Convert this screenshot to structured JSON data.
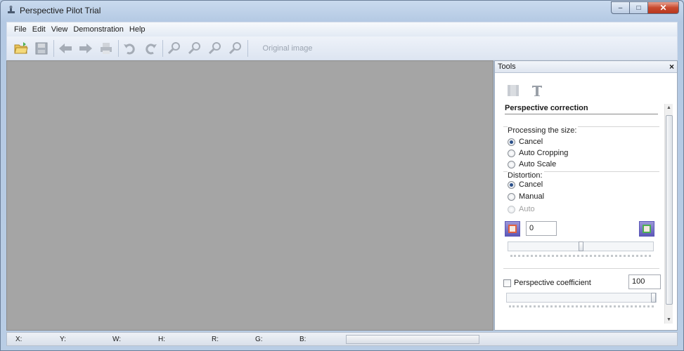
{
  "window": {
    "title": "Perspective Pilot Trial",
    "controls": {
      "minimize": "–",
      "maximize": "□",
      "close": "✕"
    }
  },
  "menu": [
    "File",
    "Edit",
    "View",
    "Demonstration",
    "Help"
  ],
  "toolbar": {
    "buttons": [
      "open-folder-icon",
      "save-icon",
      "back-arrow-icon",
      "forward-arrow-icon",
      "print-icon",
      "undo-icon",
      "redo-icon",
      "zoom-in-icon",
      "zoom-out-icon",
      "zoom-fit-icon",
      "zoom-actual-icon"
    ],
    "view_label": "Original image"
  },
  "tools_panel": {
    "title": "Tools",
    "close": "×",
    "section_title": "Perspective correction",
    "processing_size": {
      "label": "Processing the size:",
      "options": [
        "Cancel",
        "Auto Cropping",
        "Auto Scale"
      ],
      "selected": "Cancel"
    },
    "distortion": {
      "label": "Distortion:",
      "options": [
        "Cancel",
        "Manual",
        "Auto"
      ],
      "selected": "Cancel",
      "disabled": [
        "Auto"
      ],
      "value": "0",
      "slider_position": 0.5
    },
    "perspective_coefficient": {
      "label": "Perspective coefficient",
      "checked": false,
      "value": "100",
      "slider_position": 1.0
    }
  },
  "statusbar": {
    "labels": [
      "X:",
      "Y:",
      "W:",
      "H:",
      "R:",
      "G:",
      "B:"
    ]
  }
}
